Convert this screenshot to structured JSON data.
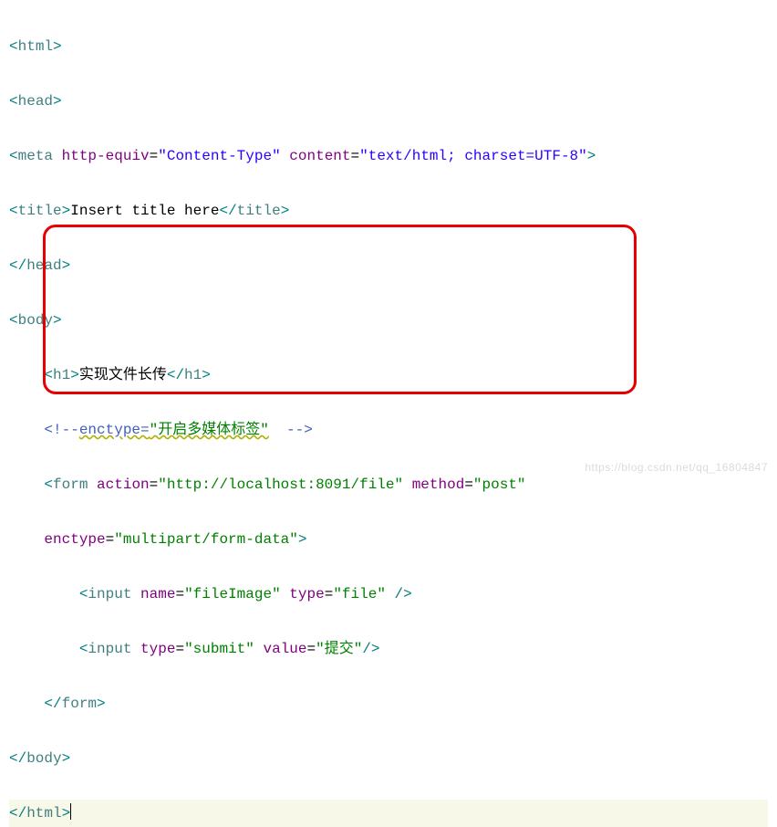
{
  "code": {
    "tags": {
      "html_open": "html",
      "html_close": "html",
      "head_open": "head",
      "head_close": "head",
      "meta": "meta",
      "title_open": "title",
      "title_close": "title",
      "body_open": "body",
      "body_close": "body",
      "h1_open": "h1",
      "h1_close": "h1",
      "form_open": "form",
      "form_close": "form",
      "input": "input"
    },
    "attrs": {
      "http_equiv": "http-equiv",
      "content": "content",
      "action": "action",
      "method": "method",
      "enctype": "enctype",
      "name": "name",
      "type": "type",
      "value": "value"
    },
    "vals": {
      "content_type": "\"Content-Type\"",
      "content_val": "\"text/html; charset=UTF-8\"",
      "enctype_cmt": "\"开启多媒体标签\"",
      "action_val": "\"http://localhost:8091/file\"",
      "method_val": "\"post\"",
      "enctype_val": "\"multipart/form-data\"",
      "input_name": "\"fileImage\"",
      "input_type_file": "\"file\"",
      "input_type_submit": "\"submit\"",
      "submit_val": "\"提交\""
    },
    "text": {
      "title_text": "Insert title here",
      "h1_text": "实现文件长传",
      "comment_open": "<!--",
      "comment_label": "enctype=",
      "comment_close": "-->"
    }
  },
  "watermark": "https://blog.csdn.net/qq_16804847"
}
